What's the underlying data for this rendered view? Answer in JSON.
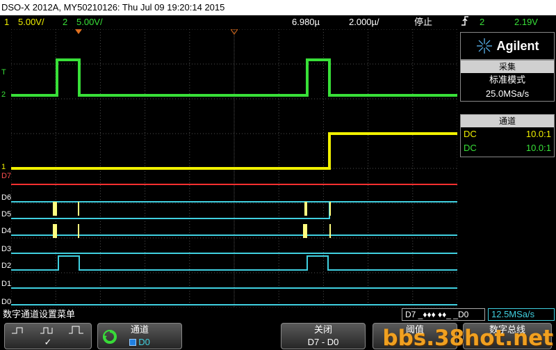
{
  "window": {
    "title": "DSO-X 2012A, MY50210126: Thu Jul 09 19:20:14 2015"
  },
  "status": {
    "ch1_num": "1",
    "ch1_scale": "5.00V/",
    "ch2_num": "2",
    "ch2_scale": "5.00V/",
    "delay": "6.980µ",
    "timebase": "2.000µ/",
    "run_state": "停止",
    "trigger_icon": "trigger-edge-icon",
    "trig_source": "2",
    "trig_level": "2.19V"
  },
  "markers": {
    "ch2": "2",
    "ch1": "1",
    "trigger": "T",
    "digital": [
      "D7",
      "D6",
      "D5",
      "D4",
      "D3",
      "D2",
      "D1",
      "D0"
    ]
  },
  "panel": {
    "brand": "Agilent",
    "acq_header": "采集",
    "acq_mode": "标准模式",
    "acq_rate": "25.0MSa/s",
    "ch_header": "通道",
    "channels": [
      {
        "coupling": "DC",
        "probe": "10.0:1",
        "color": "#f0f000"
      },
      {
        "coupling": "DC",
        "probe": "10.0:1",
        "color": "#38e038"
      }
    ]
  },
  "menu": {
    "title": "数字通道设置菜单",
    "bus_readout": "D7 _♦♦♦ ♦♦_ _D0",
    "sample_rate": "12.5MSa/s"
  },
  "softkeys": {
    "threshold_check": "✓",
    "channel_label": "通道",
    "channel_value": "D0",
    "close_label": "关闭",
    "close_value": "D7 - D0",
    "threshold_label": "阈值",
    "bus_label": "数字总线"
  },
  "watermark": "bbs.38hot.net",
  "colors": {
    "ch1": "#f0f000",
    "ch2": "#38e038",
    "digital": "#40d0e0",
    "d7": "#ff3030"
  }
}
